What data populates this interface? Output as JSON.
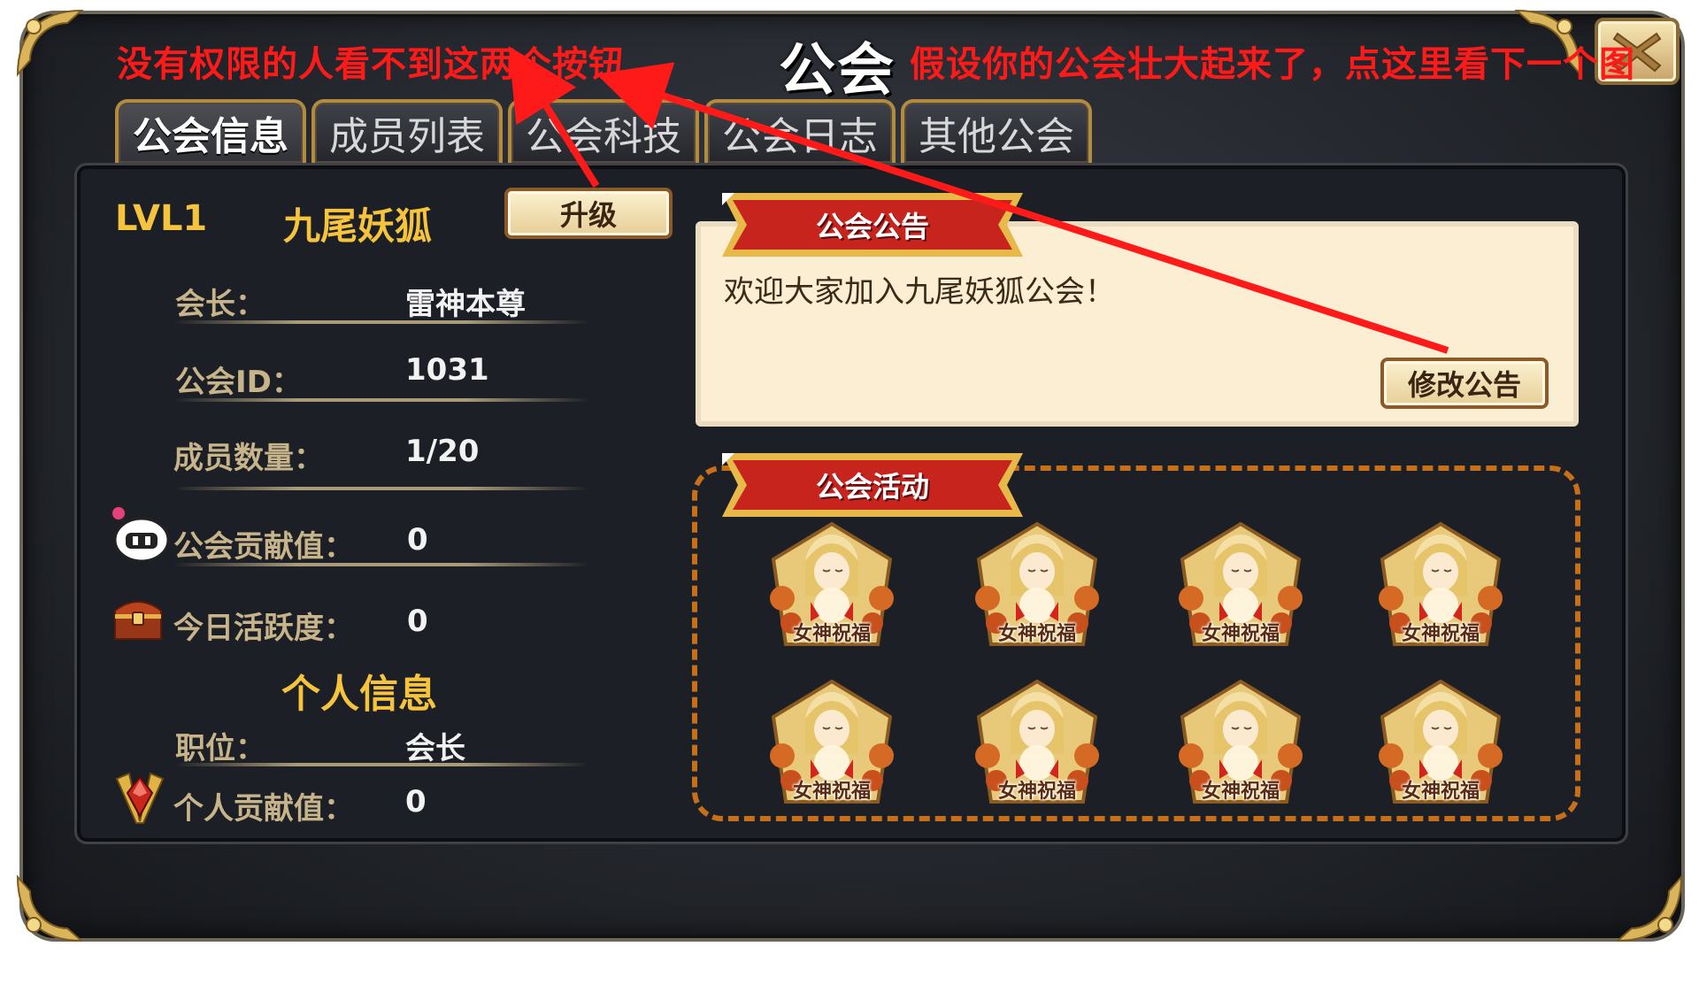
{
  "header": {
    "title": "公会",
    "close_icon": "close-x-icon"
  },
  "annotations": {
    "left_note": "没有权限的人看不到这两个按钮",
    "right_note": "假设你的公会壮大起来了，点这里看下一个图",
    "color": "#ff1a1a"
  },
  "tabs": [
    {
      "label": "公会信息",
      "active": true
    },
    {
      "label": "成员列表",
      "active": false
    },
    {
      "label": "公会科技",
      "active": false
    },
    {
      "label": "公会日志",
      "active": false
    },
    {
      "label": "其他公会",
      "active": false
    }
  ],
  "guild": {
    "level": "LVL1",
    "name": "九尾妖狐",
    "upgrade_label": "升级",
    "rows": [
      {
        "label": "会长：",
        "value": "雷神本尊"
      },
      {
        "label": "公会ID：",
        "value": "1031"
      },
      {
        "label": "成员数量：",
        "value": "1/20"
      },
      {
        "label": "公会贡献值：",
        "value": "0",
        "icon": "bomberman-icon"
      },
      {
        "label": "今日活跃度：",
        "value": "0",
        "icon": "treasure-chest-icon"
      }
    ]
  },
  "personal": {
    "title": "个人信息",
    "rows": [
      {
        "label": "职位：",
        "value": "会长"
      },
      {
        "label": "个人贡献值：",
        "value": "0",
        "icon": "red-gem-icon"
      }
    ]
  },
  "notice": {
    "banner": "公会公告",
    "text": "欢迎大家加入九尾妖狐公会！",
    "edit_label": "修改公告"
  },
  "activity": {
    "banner": "公会活动",
    "items": [
      {
        "label": "女神祝福"
      },
      {
        "label": "女神祝福"
      },
      {
        "label": "女神祝福"
      },
      {
        "label": "女神祝福"
      },
      {
        "label": "女神祝福"
      },
      {
        "label": "女神祝福"
      },
      {
        "label": "女神祝福"
      },
      {
        "label": "女神祝福"
      }
    ]
  },
  "colors": {
    "gold_text": "#f6c33d",
    "label_text": "#c7b48a",
    "panel_bg": "#1c1f25",
    "dashed_border": "#c86f1a",
    "banner_red": "#c8241e"
  }
}
